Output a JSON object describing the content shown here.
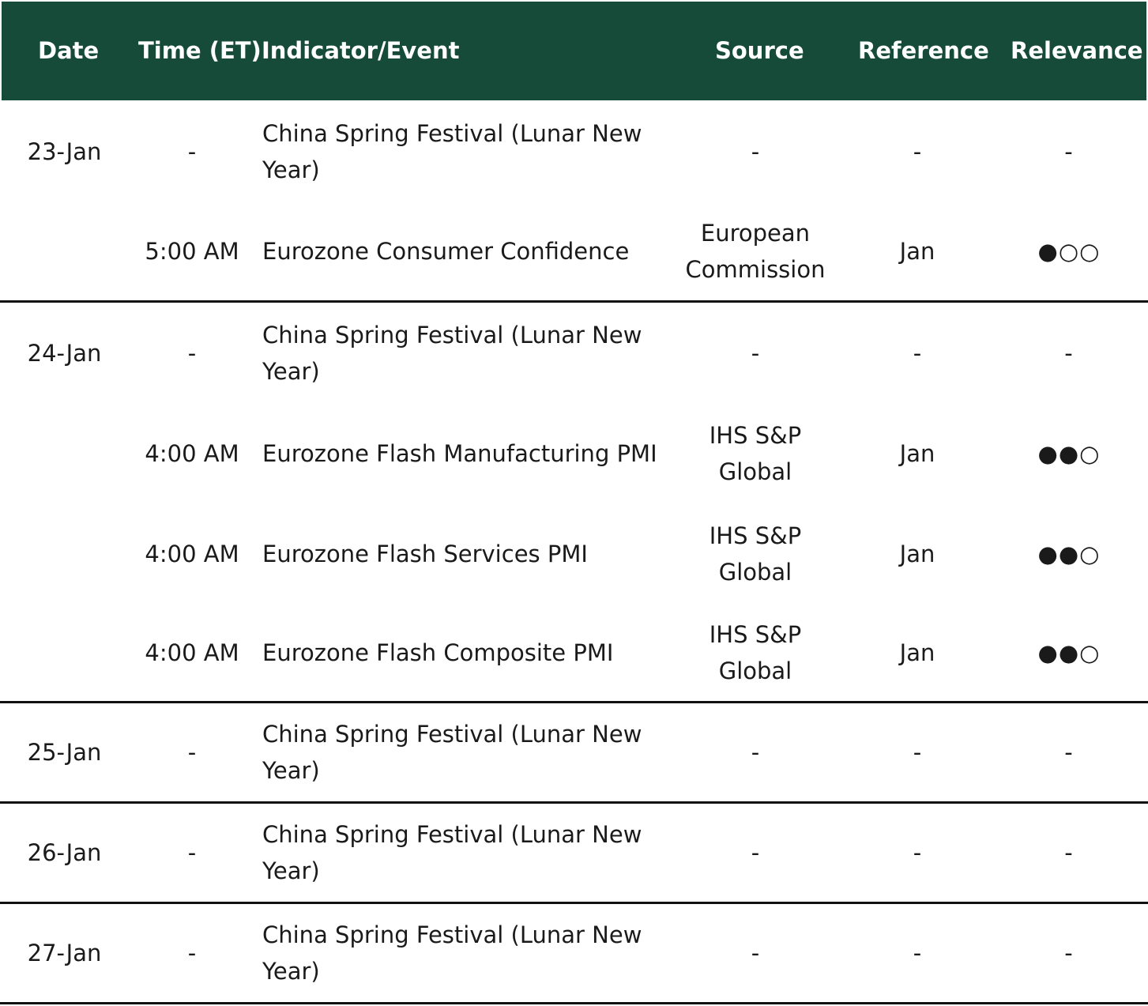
{
  "headers": {
    "date": "Date",
    "time": "Time (ET)",
    "event": "Indicator/Event",
    "source": "Source",
    "reference": "Reference",
    "relevance": "Relevance"
  },
  "rows": [
    {
      "date": "23-Jan",
      "time": "-",
      "event": "China Spring Festival (Lunar New Year)",
      "source": "-",
      "reference": "-",
      "relevance": "-"
    },
    {
      "date": "",
      "time": "5:00 AM",
      "event": "Eurozone Consumer Confidence",
      "source": "European Commission",
      "reference": "Jan",
      "relevance": "●○○"
    },
    {
      "date": "24-Jan",
      "time": "-",
      "event": "China Spring Festival (Lunar New Year)",
      "source": "-",
      "reference": "-",
      "relevance": "-"
    },
    {
      "date": "",
      "time": "4:00 AM",
      "event": "Eurozone Flash Manufacturing PMI",
      "source": "IHS S&P Global",
      "reference": "Jan",
      "relevance": "●●○"
    },
    {
      "date": "",
      "time": "4:00 AM",
      "event": "Eurozone Flash Services PMI",
      "source": "IHS S&P Global",
      "reference": "Jan",
      "relevance": "●●○"
    },
    {
      "date": "",
      "time": "4:00 AM",
      "event": "Eurozone Flash Composite PMI",
      "source": "IHS S&P Global",
      "reference": "Jan",
      "relevance": "●●○"
    },
    {
      "date": "25-Jan",
      "time": "-",
      "event": "China Spring Festival (Lunar New Year)",
      "source": "-",
      "reference": "-",
      "relevance": "-"
    },
    {
      "date": "26-Jan",
      "time": "-",
      "event": "China Spring Festival (Lunar New Year)",
      "source": "-",
      "reference": "-",
      "relevance": "-"
    },
    {
      "date": "27-Jan",
      "time": "-",
      "event": "China Spring Festival (Lunar New Year)",
      "source": "-",
      "reference": "-",
      "relevance": "-"
    }
  ],
  "colors": {
    "header_background": "#154b38",
    "header_text": "#ffffff",
    "separator": "#111111"
  }
}
